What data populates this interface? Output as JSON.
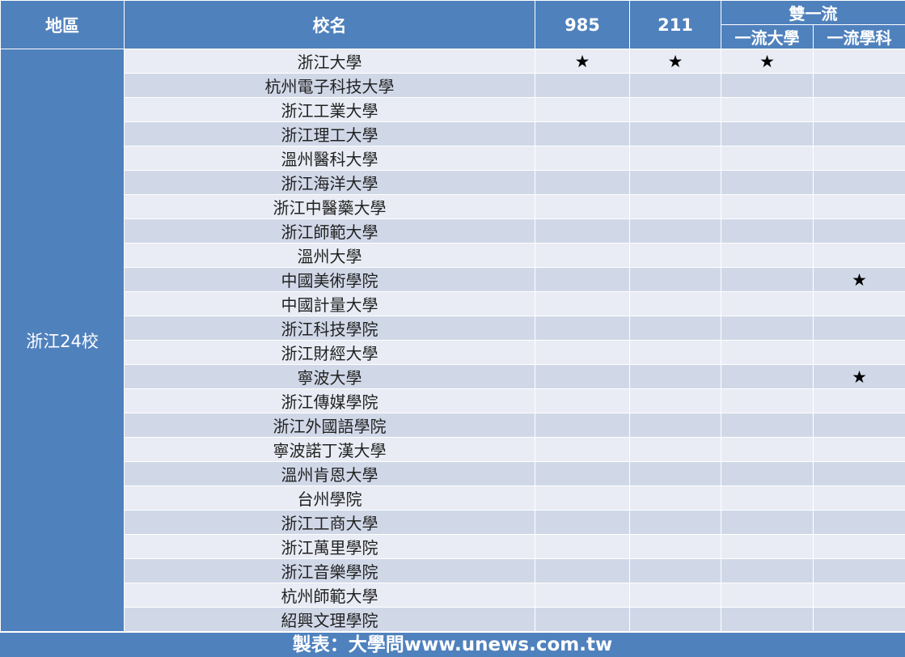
{
  "headers": {
    "region": "地區",
    "school": "校名",
    "c985": "985",
    "c211": "211",
    "double": "雙一流",
    "first_uni": "一流大學",
    "first_discipline": "一流學科"
  },
  "region_label": "浙江24校",
  "rows": [
    {
      "name": "浙江大學",
      "c985": "★",
      "c211": "★",
      "first_uni": "★",
      "first_discipline": ""
    },
    {
      "name": "杭州電子科技大學",
      "c985": "",
      "c211": "",
      "first_uni": "",
      "first_discipline": ""
    },
    {
      "name": "浙江工業大學",
      "c985": "",
      "c211": "",
      "first_uni": "",
      "first_discipline": ""
    },
    {
      "name": "浙江理工大學",
      "c985": "",
      "c211": "",
      "first_uni": "",
      "first_discipline": ""
    },
    {
      "name": "溫州醫科大學",
      "c985": "",
      "c211": "",
      "first_uni": "",
      "first_discipline": ""
    },
    {
      "name": "浙江海洋大學",
      "c985": "",
      "c211": "",
      "first_uni": "",
      "first_discipline": ""
    },
    {
      "name": "浙江中醫藥大學",
      "c985": "",
      "c211": "",
      "first_uni": "",
      "first_discipline": ""
    },
    {
      "name": "浙江師範大學",
      "c985": "",
      "c211": "",
      "first_uni": "",
      "first_discipline": ""
    },
    {
      "name": "溫州大學",
      "c985": "",
      "c211": "",
      "first_uni": "",
      "first_discipline": ""
    },
    {
      "name": "中國美術學院",
      "c985": "",
      "c211": "",
      "first_uni": "",
      "first_discipline": "★"
    },
    {
      "name": "中國計量大學",
      "c985": "",
      "c211": "",
      "first_uni": "",
      "first_discipline": ""
    },
    {
      "name": "浙江科技學院",
      "c985": "",
      "c211": "",
      "first_uni": "",
      "first_discipline": ""
    },
    {
      "name": "浙江財經大學",
      "c985": "",
      "c211": "",
      "first_uni": "",
      "first_discipline": ""
    },
    {
      "name": "寧波大學",
      "c985": "",
      "c211": "",
      "first_uni": "",
      "first_discipline": "★"
    },
    {
      "name": "浙江傳媒學院",
      "c985": "",
      "c211": "",
      "first_uni": "",
      "first_discipline": ""
    },
    {
      "name": "浙江外國語學院",
      "c985": "",
      "c211": "",
      "first_uni": "",
      "first_discipline": ""
    },
    {
      "name": "寧波諾丁漢大學",
      "c985": "",
      "c211": "",
      "first_uni": "",
      "first_discipline": ""
    },
    {
      "name": "溫州肯恩大學",
      "c985": "",
      "c211": "",
      "first_uni": "",
      "first_discipline": ""
    },
    {
      "name": "台州學院",
      "c985": "",
      "c211": "",
      "first_uni": "",
      "first_discipline": ""
    },
    {
      "name": "浙江工商大學",
      "c985": "",
      "c211": "",
      "first_uni": "",
      "first_discipline": ""
    },
    {
      "name": "浙江萬里學院",
      "c985": "",
      "c211": "",
      "first_uni": "",
      "first_discipline": ""
    },
    {
      "name": "浙江音樂學院",
      "c985": "",
      "c211": "",
      "first_uni": "",
      "first_discipline": ""
    },
    {
      "name": "杭州師範大學",
      "c985": "",
      "c211": "",
      "first_uni": "",
      "first_discipline": ""
    },
    {
      "name": "紹興文理學院",
      "c985": "",
      "c211": "",
      "first_uni": "",
      "first_discipline": ""
    }
  ],
  "footer": "製表：大學問www.unews.com.tw",
  "colors": {
    "header_bg": "#4f81bd",
    "row_light": "#e9ecf4",
    "row_dark": "#d0d8e8"
  }
}
